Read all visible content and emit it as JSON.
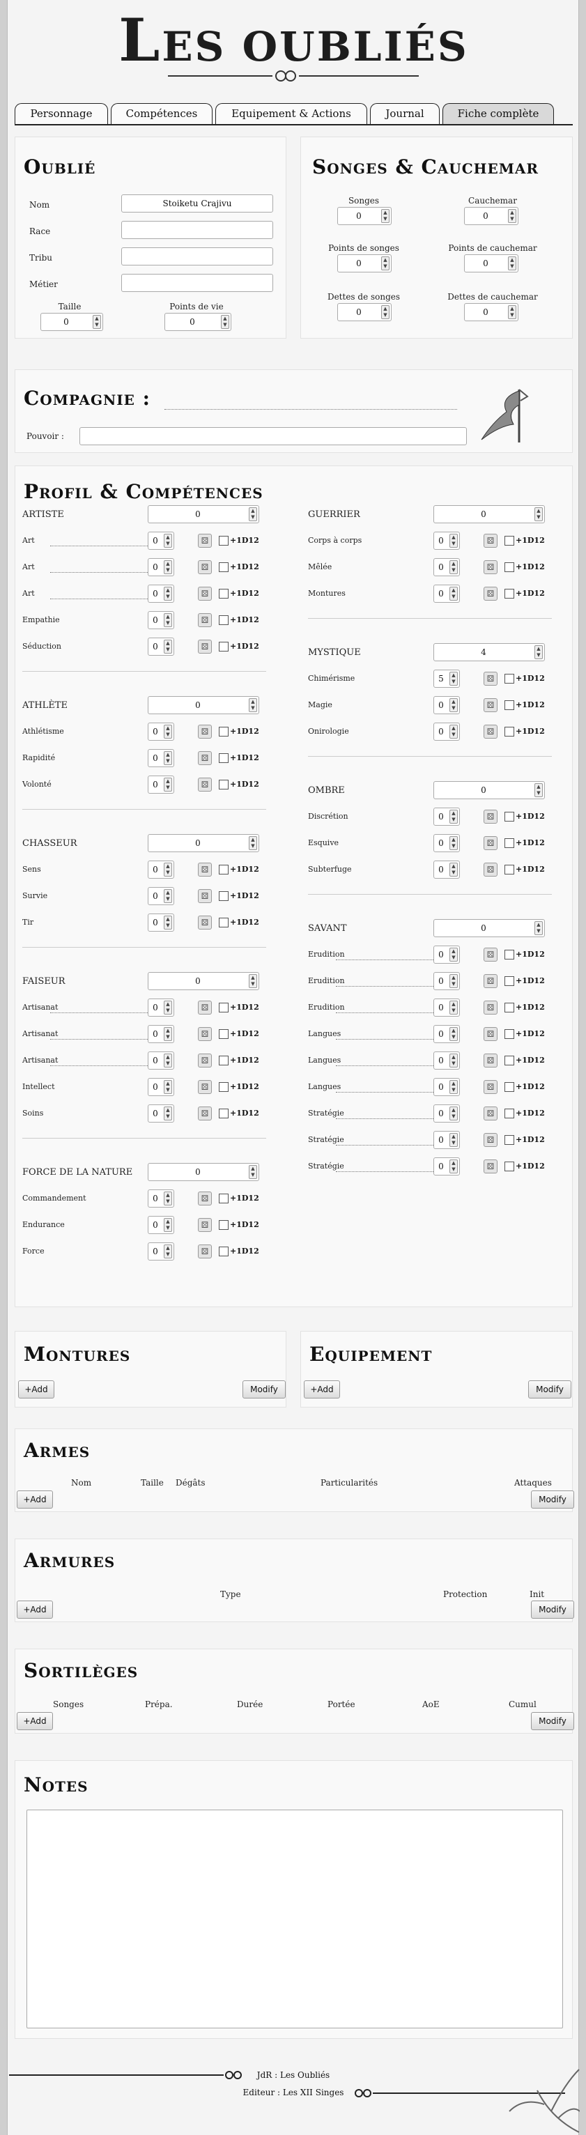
{
  "logo": {
    "text_big": "L",
    "text_rest": "ES OUBLIÉS"
  },
  "tabs": [
    {
      "label": "Personnage"
    },
    {
      "label": "Compétences"
    },
    {
      "label": "Equipement & Actions"
    },
    {
      "label": "Journal"
    },
    {
      "label": "Fiche complète"
    }
  ],
  "oublie": {
    "title": "Oublié",
    "nom_label": "Nom",
    "nom_value": "Stoiketu Crajivu",
    "race_label": "Race",
    "tribu_label": "Tribu",
    "metier_label": "Métier",
    "taille_label": "Taille",
    "taille_value": "0",
    "pv_label": "Points de vie",
    "pv_value": "0"
  },
  "songes": {
    "title": "Songes & Cauchemar",
    "fields": [
      {
        "label": "Songes",
        "value": "0"
      },
      {
        "label": "Cauchemar",
        "value": "0"
      },
      {
        "label": "Points de songes",
        "value": "0"
      },
      {
        "label": "Points de cauchemar",
        "value": "0"
      },
      {
        "label": "Dettes de songes",
        "value": "0"
      },
      {
        "label": "Dettes de cauchemar",
        "value": "0"
      }
    ]
  },
  "compagnie": {
    "title": "Compagnie :",
    "pouvoir_label": "Pouvoir :"
  },
  "profil": {
    "title": "Profil & Compétences",
    "dice_label": "+1D12",
    "left": [
      {
        "name": "ARTISTE",
        "value": "0",
        "skills": [
          {
            "name": "Art",
            "value": "0",
            "dotted": true
          },
          {
            "name": "Art",
            "value": "0",
            "dotted": true
          },
          {
            "name": "Art",
            "value": "0",
            "dotted": true
          },
          {
            "name": "Empathie",
            "value": "0"
          },
          {
            "name": "Séduction",
            "value": "0"
          }
        ]
      },
      {
        "name": "ATHLÈTE",
        "value": "0",
        "skills": [
          {
            "name": "Athlétisme",
            "value": "0"
          },
          {
            "name": "Rapidité",
            "value": "0"
          },
          {
            "name": "Volonté",
            "value": "0"
          }
        ]
      },
      {
        "name": "CHASSEUR",
        "value": "0",
        "skills": [
          {
            "name": "Sens",
            "value": "0"
          },
          {
            "name": "Survie",
            "value": "0"
          },
          {
            "name": "Tir",
            "value": "0"
          }
        ]
      },
      {
        "name": "FAISEUR",
        "value": "0",
        "skills": [
          {
            "name": "Artisanat",
            "value": "0",
            "dotted": true
          },
          {
            "name": "Artisanat",
            "value": "0",
            "dotted": true
          },
          {
            "name": "Artisanat",
            "value": "0",
            "dotted": true
          },
          {
            "name": "Intellect",
            "value": "0"
          },
          {
            "name": "Soins",
            "value": "0"
          }
        ]
      },
      {
        "name": "FORCE DE LA NATURE",
        "value": "0",
        "skills": [
          {
            "name": "Commandement",
            "value": "0"
          },
          {
            "name": "Endurance",
            "value": "0"
          },
          {
            "name": "Force",
            "value": "0"
          }
        ]
      }
    ],
    "right": [
      {
        "name": "GUERRIER",
        "value": "0",
        "skills": [
          {
            "name": "Corps à corps",
            "value": "0"
          },
          {
            "name": "Mêlée",
            "value": "0"
          },
          {
            "name": "Montures",
            "value": "0"
          }
        ]
      },
      {
        "name": "MYSTIQUE",
        "value": "4",
        "skills": [
          {
            "name": "Chimérisme",
            "value": "5"
          },
          {
            "name": "Magie",
            "value": "0"
          },
          {
            "name": "Onirologie",
            "value": "0"
          }
        ]
      },
      {
        "name": "OMBRE",
        "value": "0",
        "skills": [
          {
            "name": "Discrétion",
            "value": "0"
          },
          {
            "name": "Esquive",
            "value": "0"
          },
          {
            "name": "Subterfuge",
            "value": "0"
          }
        ]
      },
      {
        "name": "SAVANT",
        "value": "0",
        "skills": [
          {
            "name": "Erudition",
            "value": "0",
            "dotted": true
          },
          {
            "name": "Erudition",
            "value": "0",
            "dotted": true
          },
          {
            "name": "Erudition",
            "value": "0",
            "dotted": true
          },
          {
            "name": "Langues",
            "value": "0",
            "dotted": true
          },
          {
            "name": "Langues",
            "value": "0",
            "dotted": true
          },
          {
            "name": "Langues",
            "value": "0",
            "dotted": true
          },
          {
            "name": "Stratégie",
            "value": "0",
            "dotted": true
          },
          {
            "name": "Stratégie",
            "value": "0",
            "dotted": true
          },
          {
            "name": "Stratégie",
            "value": "0",
            "dotted": true
          }
        ]
      }
    ]
  },
  "montures": {
    "title": "Montures",
    "add": "+Add",
    "modify": "Modify"
  },
  "equipement": {
    "title": "Equipement",
    "add": "+Add",
    "modify": "Modify"
  },
  "armes": {
    "title": "Armes",
    "cols": [
      "Nom",
      "Taille",
      "Dégâts",
      "Particularités",
      "Attaques"
    ],
    "add": "+Add",
    "modify": "Modify"
  },
  "armures": {
    "title": "Armures",
    "cols": [
      "Type",
      "Protection",
      "Init"
    ],
    "add": "+Add",
    "modify": "Modify"
  },
  "sortileges": {
    "title": "Sortilèges",
    "cols": [
      "Songes",
      "Prépa.",
      "Durée",
      "Portée",
      "AoE",
      "Cumul"
    ],
    "add": "+Add",
    "modify": "Modify"
  },
  "notes": {
    "title": "Notes"
  },
  "footer": {
    "line1": "JdR : Les Oubliés",
    "line2": "Editeur : Les XII Singes"
  }
}
